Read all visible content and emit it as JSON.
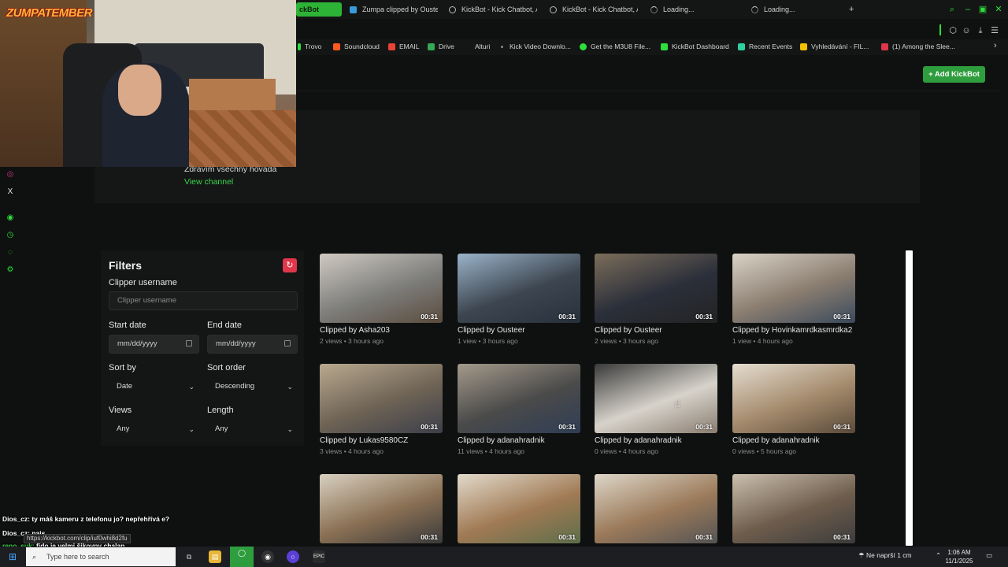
{
  "browser": {
    "tabs": [
      {
        "label": "ckBot",
        "active": true
      },
      {
        "label": "Zumpa clipped by Ousteer"
      },
      {
        "label": "KickBot - Kick Chatbot, A"
      },
      {
        "label": "KickBot - Kick Chatbot, A"
      },
      {
        "label": "Loading..."
      },
      {
        "label": "Loading..."
      }
    ],
    "new_tab_symbol": "+",
    "bookmarks": [
      {
        "label": "Trovo",
        "color": "#2ddf3a"
      },
      {
        "label": "Soundcloud",
        "color": "#ff5a1f"
      },
      {
        "label": "EMAIL",
        "color": "#ea4335"
      },
      {
        "label": "Drive",
        "color": "#34a853"
      },
      {
        "label": "Alturi",
        "color": "#888888"
      },
      {
        "label": "Kick Video Downlo...",
        "color": "#888888"
      },
      {
        "label": "Get the M3U8 File...",
        "color": "#2ddf3a"
      },
      {
        "label": "KickBot Dashboard",
        "color": "#2ddf3a"
      },
      {
        "label": "Recent Events",
        "color": "#2fd0a0"
      },
      {
        "label": "Vyhledávání - FIL...",
        "color": "#f2c200"
      },
      {
        "label": "(1) Among the Slee...",
        "color": "#e0364b"
      }
    ]
  },
  "header": {
    "add_button": "+ Add KickBot"
  },
  "channel": {
    "description": "Zdravím všechny hovada",
    "link": "View channel"
  },
  "filters": {
    "title": "Filters",
    "clipper_label": "Clipper username",
    "clipper_placeholder": "Clipper username",
    "start_label": "Start date",
    "start_placeholder": "mm/dd/yyyy",
    "end_label": "End date",
    "end_placeholder": "mm/dd/yyyy",
    "sort_by_label": "Sort by",
    "sort_by_value": "Date",
    "sort_order_label": "Sort order",
    "sort_order_value": "Descending",
    "views_label": "Views",
    "views_value": "Any",
    "length_label": "Length",
    "length_value": "Any"
  },
  "clips": [
    {
      "title": "Clipped by Asha203",
      "meta": "2 views • 3 hours ago",
      "duration": "00:31"
    },
    {
      "title": "Clipped by Ousteer",
      "meta": "1 view • 3 hours ago",
      "duration": "00:31"
    },
    {
      "title": "Clipped by Ousteer",
      "meta": "2 views • 3 hours ago",
      "duration": "00:31"
    },
    {
      "title": "Clipped by Hovinkamrdkasmrdka2",
      "meta": "1 view • 4 hours ago",
      "duration": "00:31"
    },
    {
      "title": "Clipped by Lukas9580CZ",
      "meta": "3 views • 4 hours ago",
      "duration": "00:31"
    },
    {
      "title": "Clipped by adanahradnik",
      "meta": "11 views • 4 hours ago",
      "duration": "00:31"
    },
    {
      "title": "Clipped by adanahradnik",
      "meta": "0 views • 4 hours ago",
      "duration": "00:31"
    },
    {
      "title": "Clipped by adanahradnik",
      "meta": "0 views • 5 hours ago",
      "duration": "00:31"
    },
    {
      "title": "",
      "meta": "",
      "duration": "00:31"
    },
    {
      "title": "",
      "meta": "",
      "duration": "00:31"
    },
    {
      "title": "",
      "meta": "",
      "duration": "00:31"
    },
    {
      "title": "",
      "meta": "",
      "duration": "00:31"
    }
  ],
  "overlay": {
    "logo": "ZUMPATEMBER",
    "chat": [
      {
        "user": "Dios_cz:",
        "text": "ty máš kameru z telefonu jo? nepřehřívá e?"
      },
      {
        "user": "Dios_cz:",
        "text": "najs"
      },
      {
        "user": "reno_suk:",
        "text": "fido je velmi šikovny chalan"
      }
    ],
    "url_tooltip": "https://kickbot.com/clip/iuf0whi8d2fu"
  },
  "taskbar": {
    "search_placeholder": "Type here to search",
    "weather": "Ne naprší 1 cm",
    "time": "1:06 AM",
    "date": "11/1/2025"
  }
}
